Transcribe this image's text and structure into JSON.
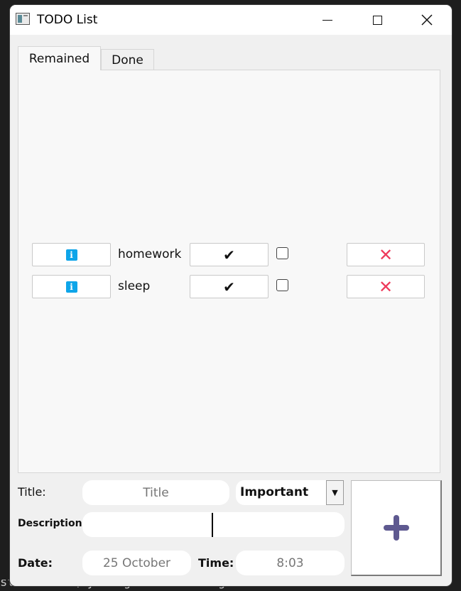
{
  "window": {
    "title": "TODO List",
    "controls": {
      "minimize": "minimize",
      "maximize": "maximize",
      "close": "close"
    }
  },
  "tabs": [
    {
      "label": "Remained",
      "selected": true
    },
    {
      "label": "Done",
      "selected": false
    }
  ],
  "tasks": [
    {
      "title": "homework",
      "done_checkbox": false
    },
    {
      "title": "sleep",
      "done_checkbox": false
    }
  ],
  "icons": {
    "info": "i",
    "check": "✔",
    "delete": "✕"
  },
  "form": {
    "title_label": "Title:",
    "title_placeholder": "Title",
    "priority_selected": "Important",
    "description_label": "Description:",
    "description_value": "",
    "date_label": "Date:",
    "date_value": "25 October",
    "time_label": "Time:",
    "time_value": "8:03"
  },
  "colors": {
    "accent_info": "#0ea5e9",
    "delete_red": "#ee3a5b",
    "add_purple": "#5e5990"
  },
  "background": {
    "bottom_text": "stance of QPyDesignerCustomWidgetCollection was found"
  }
}
